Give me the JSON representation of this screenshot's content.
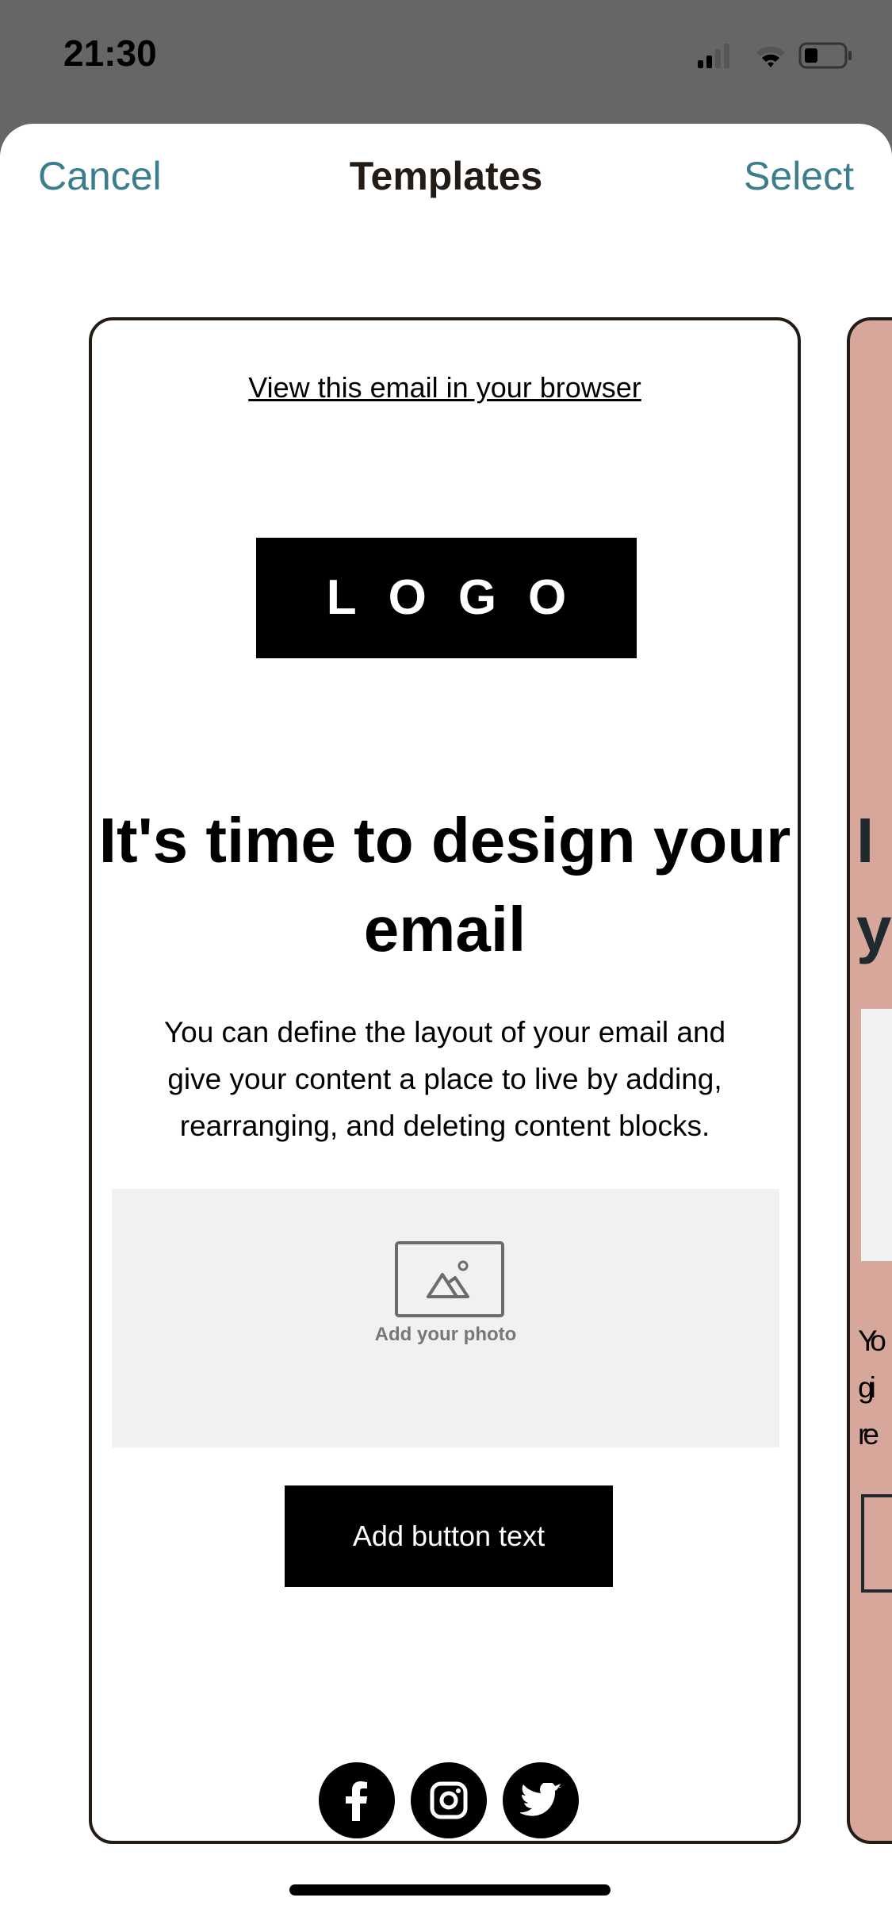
{
  "status_bar": {
    "time": "21:30",
    "signal_bars": 2,
    "battery_level": 0.35
  },
  "nav": {
    "cancel_label": "Cancel",
    "title": "Templates",
    "select_label": "Select"
  },
  "colors": {
    "accent": "#3a7d8c",
    "second_template_bg": "#d7a79b",
    "status_bar_bg": "#666666"
  },
  "template": {
    "view_in_browser": "View this email in your browser",
    "logo_text": "LOGO",
    "heading": "It's time to design your email",
    "body": "You can define the layout of your email and give your content a place to live by adding, rearranging, and deleting content blocks.",
    "photo_label": "Add your photo",
    "button_label": "Add button text",
    "social_icons": [
      "facebook-icon",
      "instagram-icon",
      "twitter-icon"
    ]
  },
  "template2": {
    "heading_partial": "I\ny",
    "body_partial": "Yo\ngi\nre"
  }
}
